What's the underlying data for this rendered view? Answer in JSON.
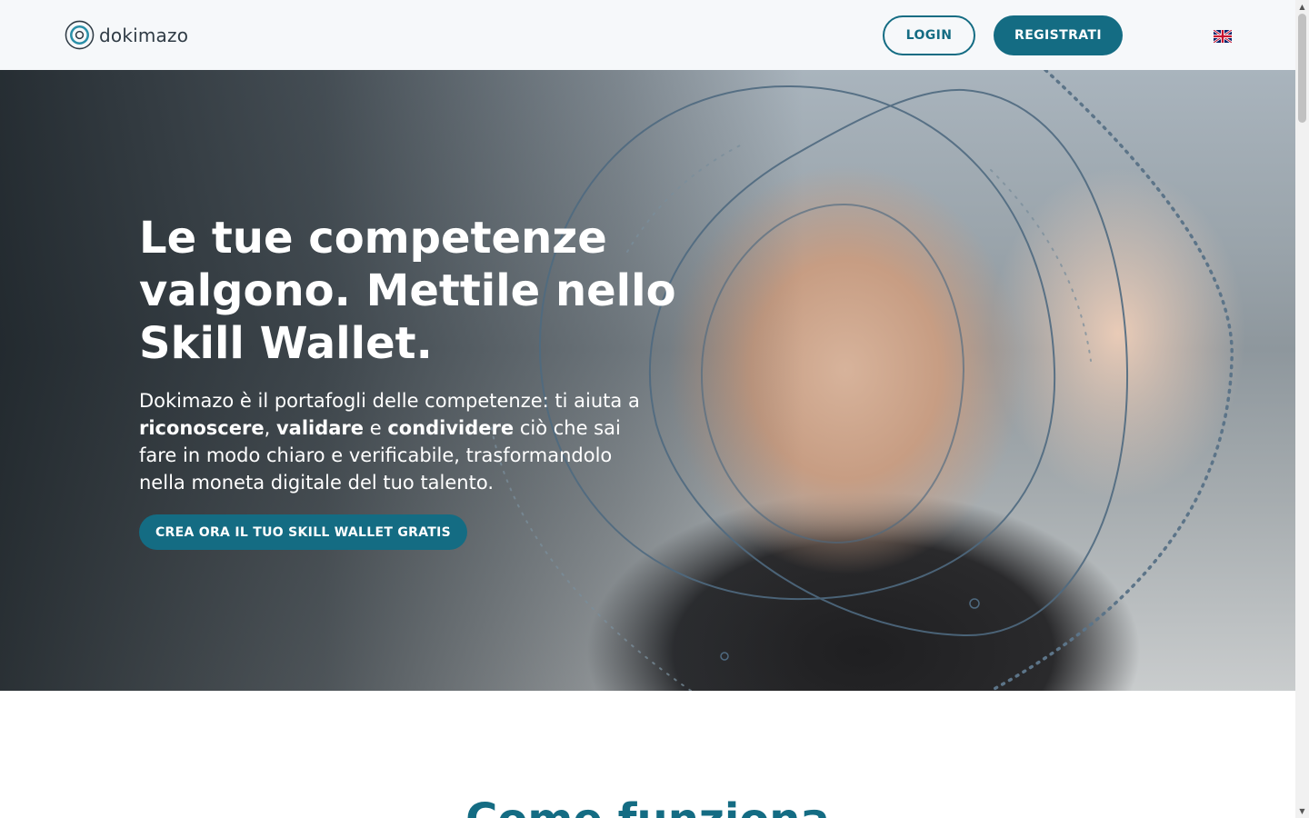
{
  "brand": {
    "name": "dokimazo"
  },
  "nav": {
    "login_label": "LOGIN",
    "register_label": "REGISTRATI",
    "language_icon": "uk-flag-icon"
  },
  "hero": {
    "title": "Le tue competenze valgono. Mettile nello Skill Wallet.",
    "desc_1": "Dokimazo è il portafogli delle competenze: ti aiuta a ",
    "desc_b1": "riconoscere",
    "desc_2": ", ",
    "desc_b2": "validare",
    "desc_3": " e ",
    "desc_b3": "condividere",
    "desc_4": " ciò che sai fare in modo chiaro e verificabile, trasformandolo nella moneta digitale del tuo talento.",
    "cta_label": "CREA ORA IL TUO SKILL WALLET GRATIS"
  },
  "section": {
    "title": "Come funziona"
  },
  "colors": {
    "accent": "#146c83",
    "header_bg": "#f6f8fa",
    "text_dark": "#2f3b45"
  }
}
